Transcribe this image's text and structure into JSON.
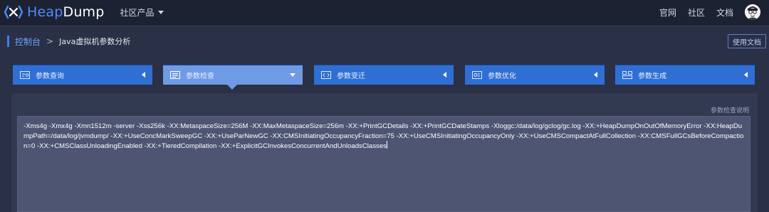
{
  "header": {
    "logo_part1": "Heap",
    "logo_part2": "Dump",
    "product_menu": "社区产品",
    "nav": [
      "官网",
      "社区",
      "文档"
    ]
  },
  "breadcrumb": {
    "home": "控制台",
    "separator": ">",
    "current": "Java虚拟机参数分析",
    "doc_button": "使用文档"
  },
  "tabs": [
    {
      "label": "参数查询",
      "icon": "search-doc-icon",
      "active": false
    },
    {
      "label": "参数检查",
      "icon": "checklist-icon",
      "active": true
    },
    {
      "label": "参数变迁",
      "icon": "code-brackets-icon",
      "active": false
    },
    {
      "label": "参数优化",
      "icon": "optimize-icon",
      "active": false
    },
    {
      "label": "参数生成",
      "icon": "generate-icon",
      "active": false
    }
  ],
  "panel": {
    "help_link": "参数检查说明",
    "editor_value": "-Xms4g -Xmx4g -Xmn1512m -server -Xss256k -XX:MetaspaceSize=256M  -XX:MaxMetaspaceSize=256m -XX:+PrintGCDetails -XX:+PrintGCDateStamps -Xloggc:/data/log/gclog/gc.log -XX:+HeapDumpOnOutOfMemoryError -XX:HeapDumpPath=/data/log/jvmdump/ -XX:+UseConcMarkSweepGC -XX:+UseParNewGC  -XX:CMSInitiatingOccupancyFraction=75 -XX:+UseCMSInitiatingOccupancyOnly -XX:+UseCMSCompactAtFullCollection -XX:CMSFullGCsBeforeCompaction=0 -XX:+CMSClassUnloadingEnabled -XX:+TieredCompilation  -XX:+ExplicitGCInvokesConcurrentAndUnloadsClasses"
  },
  "colors": {
    "accent": "#2f6fd4",
    "active_tab": "#6f9be6",
    "topbar": "#1d2233",
    "background": "#2a3045"
  }
}
